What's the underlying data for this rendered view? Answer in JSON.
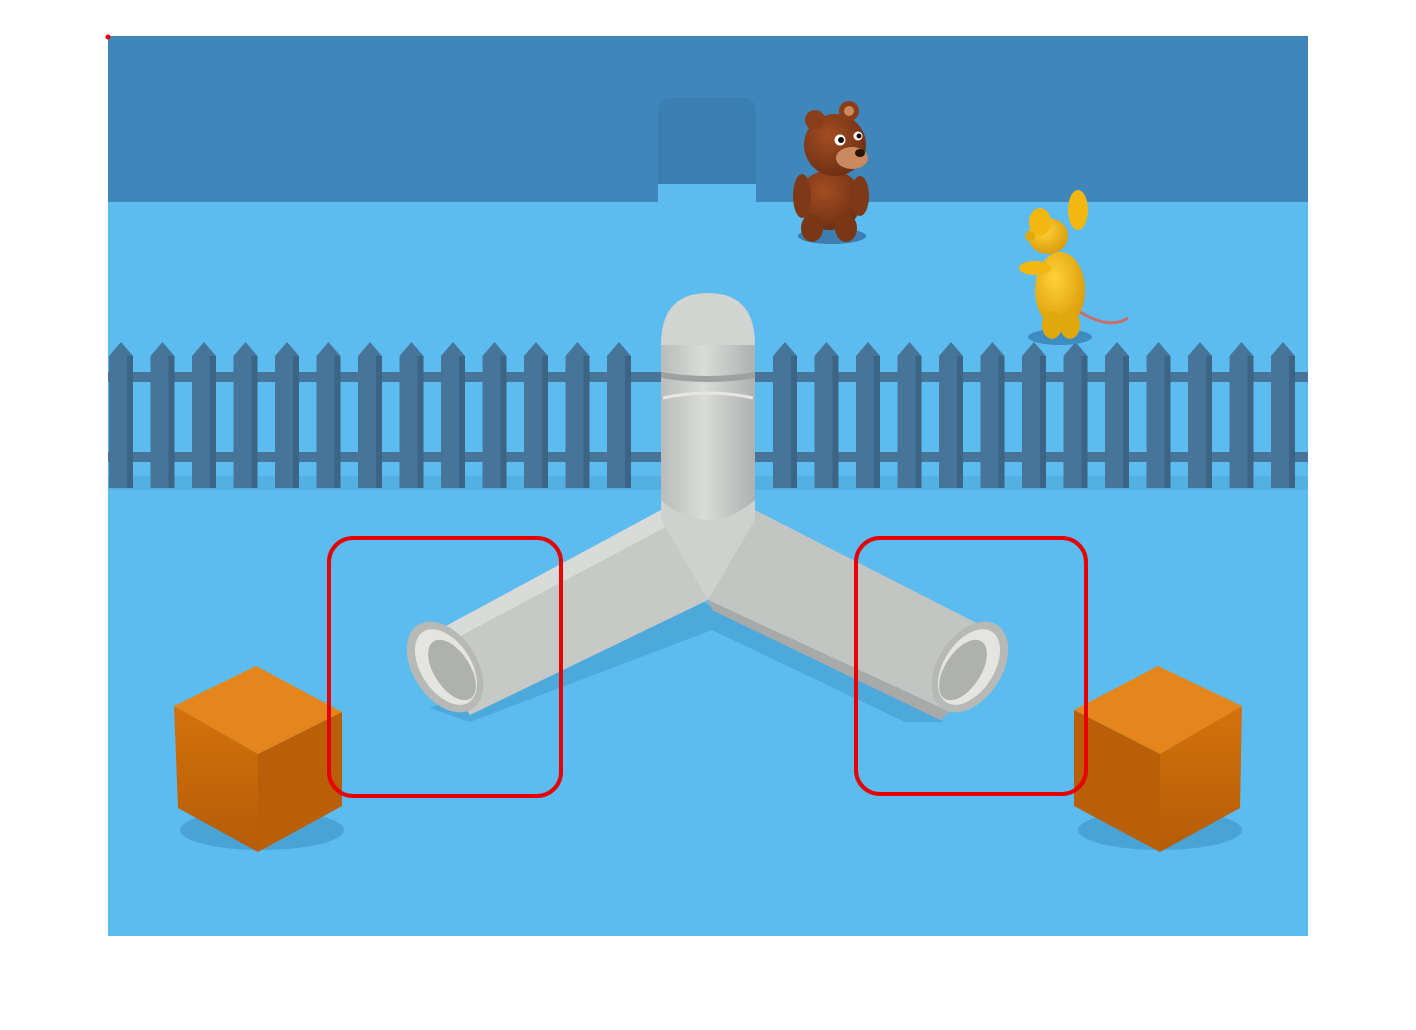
{
  "scene": {
    "name": "pipe-puzzle-level",
    "colors": {
      "back_wall": "#3f87bb",
      "floor": "#5cbcef",
      "fence": "#47759a",
      "fence_dark": "#3b6485",
      "pipe": "#c9cbc8",
      "pipe_shade": "#a9acaa",
      "crate": "#d9770f",
      "crate_top": "#e4861c",
      "crate_dark": "#b85f08",
      "bear": "#8a3f1a",
      "mouse": "#f2b811",
      "highlight": "#e60000"
    },
    "objects": [
      {
        "type": "y-pipe",
        "icon": "pipe-junction-icon"
      },
      {
        "type": "crate",
        "side": "left",
        "icon": "crate-icon"
      },
      {
        "type": "crate",
        "side": "right",
        "icon": "crate-icon"
      },
      {
        "type": "character",
        "name": "bear",
        "icon": "bear-icon"
      },
      {
        "type": "character",
        "name": "mouse",
        "icon": "mouse-icon"
      },
      {
        "type": "fence",
        "icon": "fence-icon"
      }
    ],
    "highlights": [
      {
        "target": "left-pipe-opening"
      },
      {
        "target": "right-pipe-opening"
      }
    ]
  }
}
